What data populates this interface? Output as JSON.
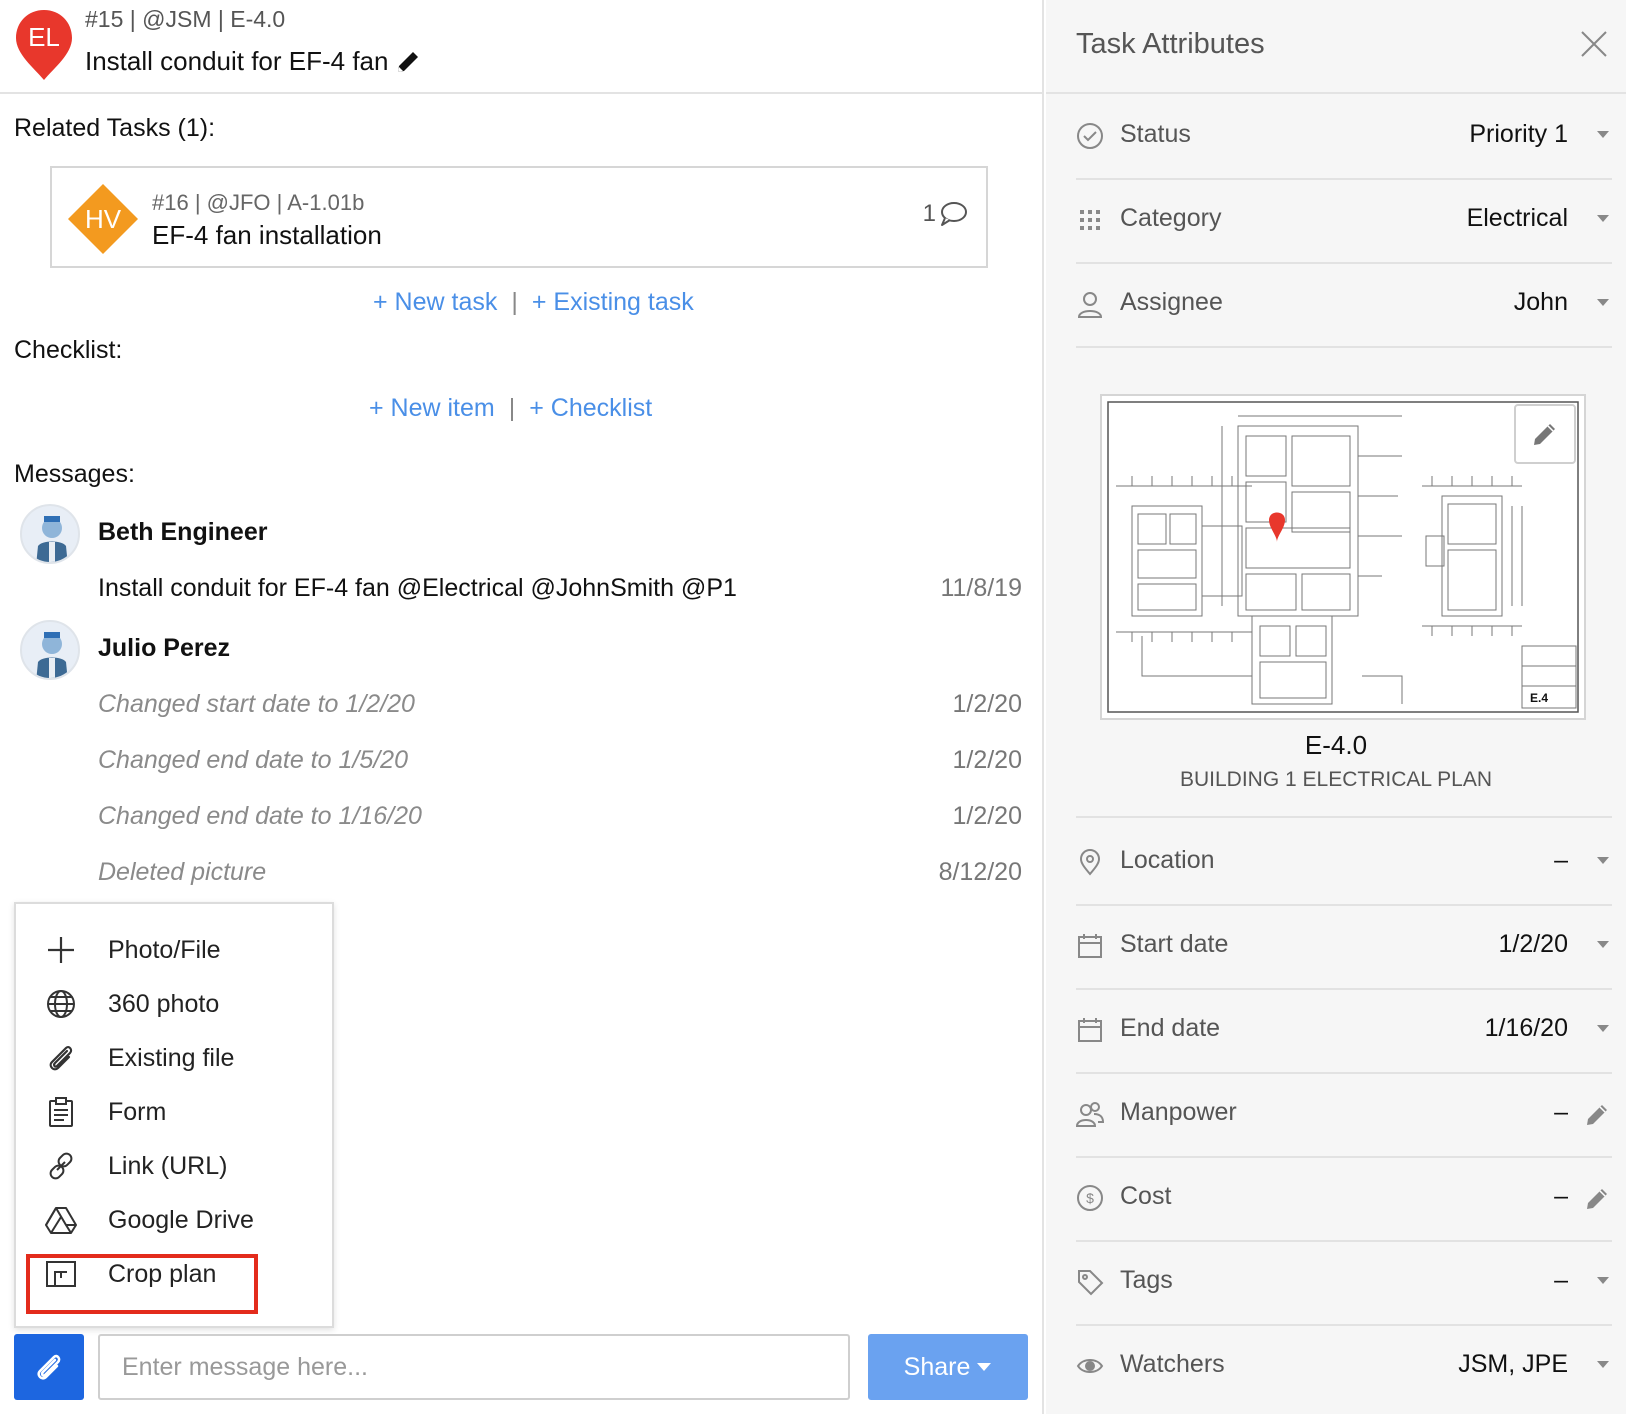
{
  "task": {
    "avatar_initials": "EL",
    "meta": "#15 | @JSM | E-4.0",
    "title": "Install conduit for EF-4 fan"
  },
  "related": {
    "label": "Related Tasks (1):",
    "items": [
      {
        "initials": "HV",
        "meta": "#16 | @JFO | A-1.01b",
        "title": "EF-4 fan installation",
        "comments": "1"
      }
    ],
    "new_task": "+ New task",
    "existing_task": "+ Existing task",
    "separator": "|"
  },
  "checklist": {
    "label": "Checklist:",
    "new_item": "+ New item",
    "checklist_link": "+ Checklist",
    "separator": "|"
  },
  "messages": {
    "label": "Messages:",
    "items": [
      {
        "author": "Beth Engineer",
        "text": "Install conduit for EF-4 fan @Electrical @JohnSmith  @P1",
        "date": "11/8/19"
      }
    ],
    "second_author": "Julio Perez",
    "logs": [
      {
        "text": "Changed start date to 1/2/20",
        "date": "1/2/20"
      },
      {
        "text": "Changed end date to 1/5/20",
        "date": "1/2/20"
      },
      {
        "text": "Changed end date to 1/16/20",
        "date": "1/2/20"
      },
      {
        "text": "Deleted picture",
        "date": "8/12/20"
      }
    ]
  },
  "attach_menu": {
    "items": [
      {
        "label": "Photo/File",
        "icon": "plus-icon"
      },
      {
        "label": "360 photo",
        "icon": "globe-icon"
      },
      {
        "label": "Existing file",
        "icon": "paperclip-icon"
      },
      {
        "label": "Form",
        "icon": "clipboard-icon"
      },
      {
        "label": "Link (URL)",
        "icon": "link-icon"
      },
      {
        "label": "Google Drive",
        "icon": "google-drive-icon"
      },
      {
        "label": "Crop plan",
        "icon": "crop-plan-icon"
      }
    ],
    "highlighted": "Crop plan",
    "highlight_color": "#e32b1c"
  },
  "composer": {
    "placeholder": "Enter message here...",
    "share_label": "Share"
  },
  "attributes": {
    "title": "Task Attributes",
    "rows_top": [
      {
        "label": "Status",
        "value": "Priority 1",
        "icon": "check-circle-icon"
      },
      {
        "label": "Category",
        "value": "Electrical",
        "icon": "grid-dots-icon"
      },
      {
        "label": "Assignee",
        "value": "John",
        "icon": "user-icon"
      }
    ],
    "plan": {
      "name": "E-4.0",
      "description": "BUILDING 1 ELECTRICAL PLAN",
      "sheet_label": "E.4"
    },
    "rows_bottom": [
      {
        "label": "Location",
        "value": "–",
        "icon": "location-pin-icon",
        "control": "caret"
      },
      {
        "label": "Start date",
        "value": "1/2/20",
        "icon": "calendar-icon",
        "control": "caret"
      },
      {
        "label": "End date",
        "value": "1/16/20",
        "icon": "calendar-icon",
        "control": "caret"
      },
      {
        "label": "Manpower",
        "value": "–",
        "icon": "people-icon",
        "control": "pencil"
      },
      {
        "label": "Cost",
        "value": "–",
        "icon": "dollar-icon",
        "control": "pencil"
      },
      {
        "label": "Tags",
        "value": "–",
        "icon": "tag-icon",
        "control": "caret"
      },
      {
        "label": "Watchers",
        "value": "JSM, JPE",
        "icon": "eye-icon",
        "control": "caret"
      }
    ]
  },
  "colors": {
    "accent": "#1d66e0",
    "link": "#4a8fe7",
    "share": "#6aa2f0",
    "pin_red": "#e8372c",
    "diamond_orange": "#f39a1f"
  }
}
